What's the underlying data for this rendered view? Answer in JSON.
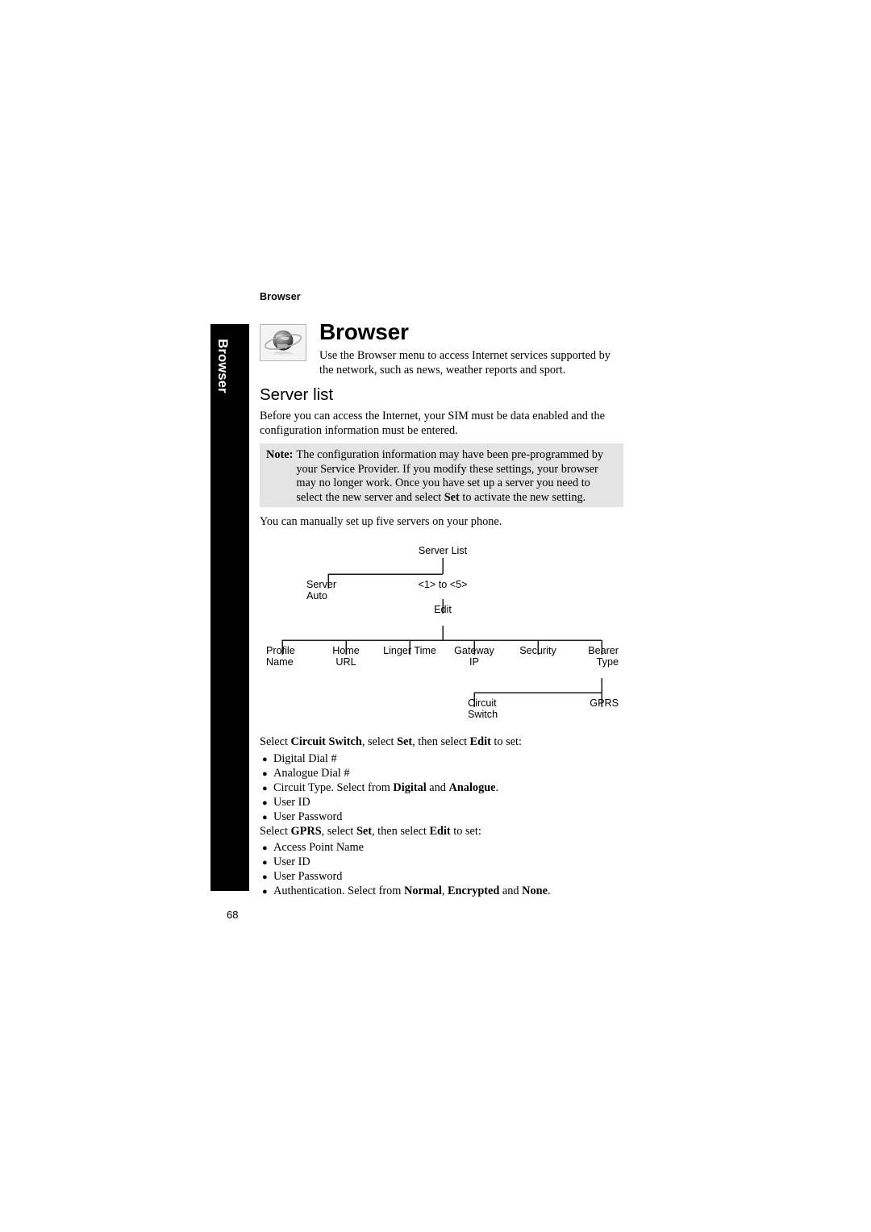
{
  "page": {
    "number": "68",
    "running_header": "Browser",
    "chapter_tab_label": "Browser"
  },
  "chapter": {
    "title": "Browser",
    "icon": "globe-orbit-icon",
    "intro": "Use the Browser menu to access Internet services supported by the network, such as news, weather reports and sport."
  },
  "section": {
    "heading": "Server list",
    "intro": "Before you can access the Internet, your SIM must be data enabled and the configuration information must be entered.",
    "manual_note": "You can manually set up five servers on your phone."
  },
  "note": {
    "label": "Note:",
    "line1_a": "The configuration information may have been pre-programmed by your Service Provider. If you modify these settings, your browser may no longer work.",
    "line2_a": "Once you have set up a server you need to select the new server and select ",
    "line2_bold": "Set",
    "line2_b": " to activate the new setting."
  },
  "tree": {
    "type": "menu-hierarchy",
    "root": "Server List",
    "nodes": {
      "server_list": "Server List",
      "server_auto": "Server\nAuto",
      "one_to_five": "<1> to <5>",
      "edit": "Edit",
      "profile_name": "Profile\nName",
      "home_url": "Home\nURL",
      "linger_time": "Linger Time",
      "gateway_ip": "Gateway\nIP",
      "security": "Security",
      "bearer_type": "Bearer\nType",
      "circuit_switch": "Circuit\nSwitch",
      "gprs": "GPRS"
    }
  },
  "circuit_section": {
    "lead_a": "Select ",
    "lead_b1": "Circuit Switch",
    "lead_c": ", select ",
    "lead_b2": "Set",
    "lead_d": ", then select ",
    "lead_b3": "Edit",
    "lead_e": " to set:",
    "bullet_char": "●",
    "items": [
      {
        "text": "Digital Dial #"
      },
      {
        "text": "Analogue Dial #"
      },
      {
        "pre": "Circuit Type. Select from ",
        "b1": "Digital",
        "mid": " and ",
        "b2": "Analogue",
        "post": "."
      },
      {
        "text": "User ID"
      },
      {
        "text": "User Password"
      }
    ]
  },
  "gprs_section": {
    "lead_a": "Select ",
    "lead_b1": "GPRS",
    "lead_c": ", select ",
    "lead_b2": "Set",
    "lead_d": ", then select ",
    "lead_b3": "Edit",
    "lead_e": " to set:",
    "items": [
      {
        "text": "Access Point Name"
      },
      {
        "text": "User ID"
      },
      {
        "text": "User Password"
      },
      {
        "pre": "Authentication. Select from ",
        "b1": "Normal",
        "mid": ", ",
        "b2": "Encrypted",
        "mid2": " and ",
        "b3": "None",
        "post": "."
      }
    ]
  },
  "colors": {
    "note_bg": "#e4e4e4",
    "tab_bg": "#000000",
    "text": "#000000",
    "rule": "#1a1a1a"
  }
}
